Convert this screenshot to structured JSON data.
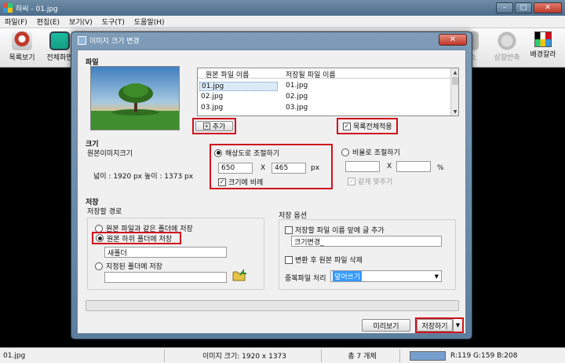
{
  "main_window": {
    "title": "하씨 - 01.jpg",
    "menu": [
      "파일(F)",
      "편집(E)",
      "보기(V)",
      "도구(T)",
      "도움말(H)"
    ],
    "toolbar_left": [
      "목록보기",
      "전체화면"
    ],
    "toolbar_right": [
      "소",
      "상향반축",
      "배경칼라"
    ],
    "status": {
      "filename": "01.jpg",
      "image_size": "이미지 크기: 1920 x 1373",
      "total": "총 7 개체",
      "color_readout": "R:119 G:159 B:208",
      "swatch_color": "#779fd0"
    }
  },
  "dialog": {
    "title": "이미지 크기 변경",
    "file_section": {
      "title": "파일",
      "columns": [
        "원본 파일 이름",
        "저장될 파일 이름"
      ],
      "rows": [
        {
          "source": "01.jpg",
          "target": "01.jpg"
        },
        {
          "source": "02.jpg",
          "target": "02.jpg"
        },
        {
          "source": "03.jpg",
          "target": "03.jpg"
        }
      ],
      "add_button": "추가",
      "apply_all_label": "목록전체적용"
    },
    "size_section": {
      "title": "크기",
      "original_label": "원본이미지크기",
      "original_size": "넓이 :   1920 px   높이 : 1373 px",
      "by_resolution_label": "해상도로 조절하기",
      "width_value": "650",
      "height_value": "465",
      "x_sign": "X",
      "px_unit": "px",
      "keep_ratio_label": "크기에 비례",
      "by_ratio_label": "비율로 조절하기",
      "percent_unit": "%",
      "same_fit_label": "같게 맞추기"
    },
    "save_section": {
      "title": "저장",
      "path_label": "저장할 경로",
      "same_folder_label": "원본 파일과 같은 폴더에 저장",
      "sub_folder_label": "원본 하위 폴더에 저장",
      "sub_folder_value": "새폴더",
      "custom_folder_label": "지정된 폴더에 저장",
      "custom_folder_value": ""
    },
    "save_options": {
      "title": "저장 옵션",
      "prefix_label": "저장할 파일 이름 앞에 글 추가",
      "prefix_value": "크기변경_",
      "delete_original_label": "변환 후 원본 파일 삭제",
      "duplicate_label": "중복파일 처리",
      "duplicate_value": "덮어쓰기"
    },
    "buttons": {
      "preview": "미리보기",
      "save": "저장하기"
    },
    "progress": 0
  }
}
